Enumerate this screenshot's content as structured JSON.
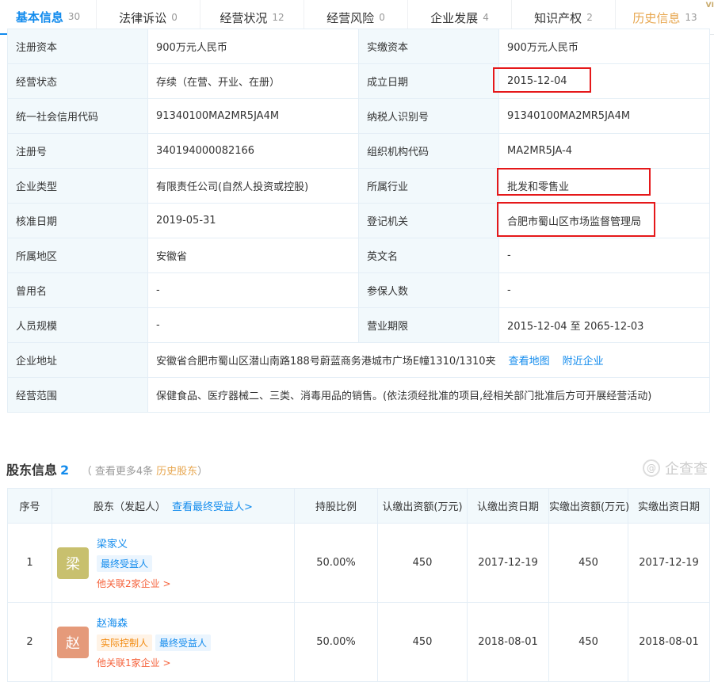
{
  "tabs": [
    {
      "label": "基本信息",
      "count": "30"
    },
    {
      "label": "法律诉讼",
      "count": "0"
    },
    {
      "label": "经营状况",
      "count": "12"
    },
    {
      "label": "经营风险",
      "count": "0"
    },
    {
      "label": "企业发展",
      "count": "4"
    },
    {
      "label": "知识产权",
      "count": "2"
    },
    {
      "label": "历史信息",
      "count": "13"
    }
  ],
  "vip_badge": "VI",
  "info": {
    "r0": {
      "l1": "注册资本",
      "v1": "900万元人民币",
      "l2": "实缴资本",
      "v2": "900万元人民币"
    },
    "r1": {
      "l1": "经营状态",
      "v1": "存续（在营、开业、在册）",
      "l2": "成立日期",
      "v2": "2015-12-04"
    },
    "r2": {
      "l1": "统一社会信用代码",
      "v1": "91340100MA2MR5JA4M",
      "l2": "纳税人识别号",
      "v2": "91340100MA2MR5JA4M"
    },
    "r3": {
      "l1": "注册号",
      "v1": "340194000082166",
      "l2": "组织机构代码",
      "v2": "MA2MR5JA-4"
    },
    "r4": {
      "l1": "企业类型",
      "v1": "有限责任公司(自然人投资或控股)",
      "l2": "所属行业",
      "v2": "批发和零售业"
    },
    "r5": {
      "l1": "核准日期",
      "v1": "2019-05-31",
      "l2": "登记机关",
      "v2": "合肥市蜀山区市场监督管理局"
    },
    "r6": {
      "l1": "所属地区",
      "v1": "安徽省",
      "l2": "英文名",
      "v2": "-"
    },
    "r7": {
      "l1": "曾用名",
      "v1": "-",
      "l2": "参保人数",
      "v2": "-"
    },
    "r8": {
      "l1": "人员规模",
      "v1": "-",
      "l2": "营业期限",
      "v2": "2015-12-04 至 2065-12-03"
    },
    "address": {
      "label": "企业地址",
      "value": "安徽省合肥市蜀山区潜山南路188号蔚蓝商务港城市广场E幢1310/1310夹",
      "map_link": "查看地图",
      "nearby_link": "附近企业"
    },
    "scope": {
      "label": "经营范围",
      "value": "保健食品、医疗器械二、三类、消毒用品的销售。(依法须经批准的项目,经相关部门批准后方可开展经营活动)"
    }
  },
  "shareholders": {
    "title": "股东信息",
    "count": "2",
    "sub_prefix": "（ 查看更多4条",
    "sub_link": "历史股东",
    "sub_suffix": "）",
    "watermark": "企查查",
    "headers": {
      "seq": "序号",
      "holder": "股东（发起人）",
      "holder_link": "查看最终受益人>",
      "ratio": "持股比例",
      "sub_amount": "认缴出资额(万元)",
      "sub_date": "认缴出资日期",
      "paid_amount": "实缴出资额(万元)",
      "paid_date": "实缴出资日期"
    },
    "rows": [
      {
        "seq": "1",
        "avatar": "梁",
        "avatar_color": "#c8c06e",
        "name": "梁家义",
        "tag_a": "",
        "tag_b": "最终受益人",
        "rel": "他关联2家企业 >",
        "ratio": "50.00%",
        "sub_amount": "450",
        "sub_date": "2017-12-19",
        "paid_amount": "450",
        "paid_date": "2017-12-19"
      },
      {
        "seq": "2",
        "avatar": "赵",
        "avatar_color": "#e59a7a",
        "name": "赵海森",
        "tag_a": "实际控制人",
        "tag_b": "最终受益人",
        "rel": "他关联1家企业 >",
        "ratio": "50.00%",
        "sub_amount": "450",
        "sub_date": "2018-08-01",
        "paid_amount": "450",
        "paid_date": "2018-08-01"
      }
    ]
  },
  "colors": {
    "accent": "#128bed",
    "history": "#e7a64e",
    "highlight": "#e5181a"
  }
}
